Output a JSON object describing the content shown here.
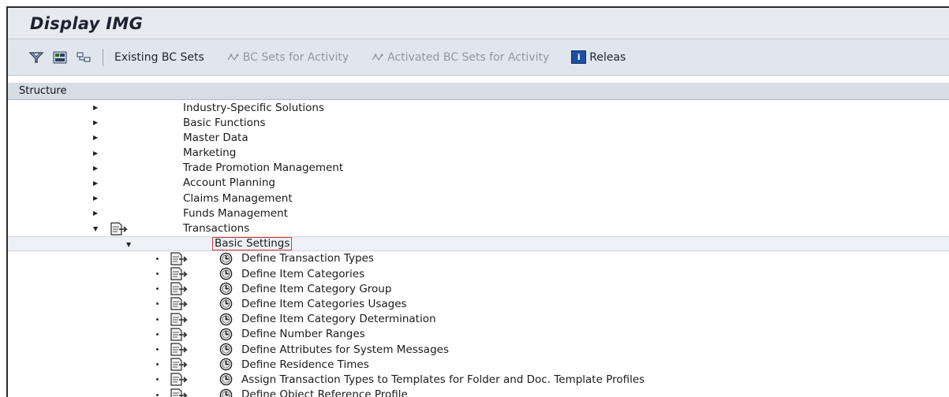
{
  "window": {
    "title": "Display IMG"
  },
  "toolbar": {
    "existing_bc_sets": "Existing BC Sets",
    "bc_sets_for_activity": "BC Sets for Activity",
    "activated_bc_sets": "Activated BC Sets for Activity",
    "release_label": "Releas",
    "release_icon_text": "i"
  },
  "structure": {
    "header": "Structure",
    "top_items": [
      "Industry-Specific Solutions",
      "Basic Functions",
      "Master Data",
      "Marketing",
      "Trade Promotion Management",
      "Account Planning",
      "Claims Management",
      "Funds Management",
      "Transactions"
    ],
    "sub_node": "Basic Settings",
    "leaf_items": [
      "Define Transaction Types",
      "Define Item Categories",
      "Define Item Category Group",
      "Define Item Categories Usages",
      "Define Item Category Determination",
      "Define Number Ranges",
      "Define Attributes for System Messages",
      "Define Residence Times",
      "Assign Transaction Types to Templates for Folder and Doc. Template Profiles",
      "Define Object Reference Profile"
    ]
  },
  "icons": {
    "toolbar": [
      "filter-icon",
      "display-icon",
      "hierarchy-icon"
    ],
    "node": "document-execute-icon",
    "activity": "clock-icon"
  },
  "colors": {
    "selection_border": "#d23a3a",
    "release_icon": "#1f4fa3"
  }
}
